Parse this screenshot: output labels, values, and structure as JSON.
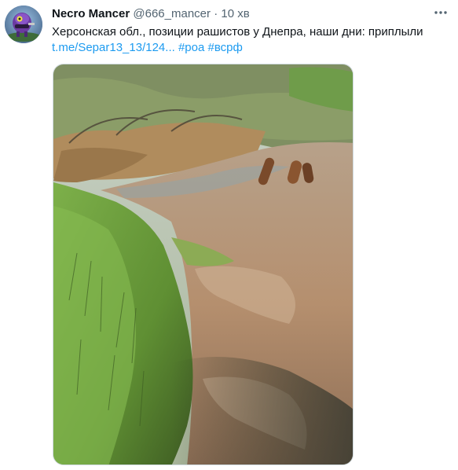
{
  "author": {
    "name": "Necro Mancer",
    "handle": "@666_mancer",
    "separator": "·",
    "timestamp": "10 хв"
  },
  "tweet": {
    "text": "Херсонская обл., позиции рашистов у Днепра, наши дни: приплыли",
    "link": "t.me/Separ13_13/124...",
    "hashtags": [
      "#роа",
      "#всрф"
    ]
  },
  "icons": {
    "more": "more-horizontal-icon",
    "avatar": "avatar-image"
  },
  "colors": {
    "link": "#1d9bf0",
    "secondary_text": "#536471",
    "primary_text": "#0f1419"
  }
}
